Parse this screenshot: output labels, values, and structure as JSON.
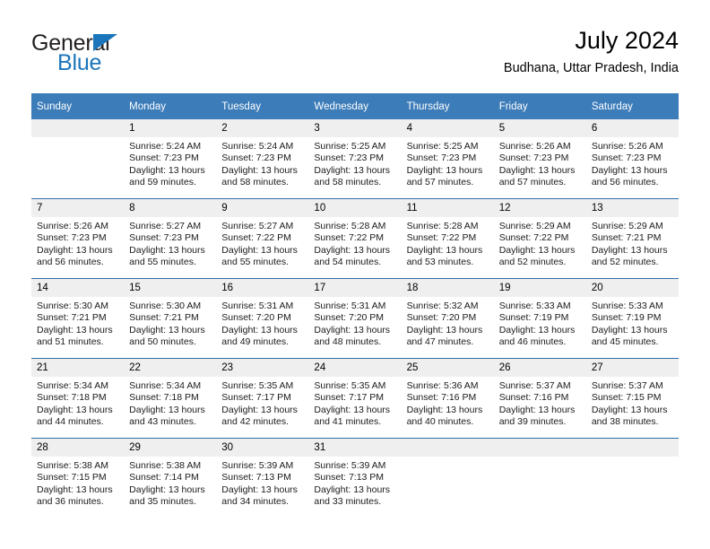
{
  "brand": {
    "name_part1": "General",
    "name_part2": "Blue",
    "colors": {
      "accent": "#1b75bb",
      "header": "#3b7cb9",
      "daynum_band": "#efefef",
      "week_divider": "#2f6fa8"
    }
  },
  "header": {
    "title": "July 2024",
    "subtitle": "Budhana, Uttar Pradesh, India"
  },
  "weekdays": [
    "Sunday",
    "Monday",
    "Tuesday",
    "Wednesday",
    "Thursday",
    "Friday",
    "Saturday"
  ],
  "weeks": [
    [
      {
        "day": "",
        "sunrise": "",
        "sunset": "",
        "daylight": "",
        "blank": true
      },
      {
        "day": "1",
        "sunrise": "Sunrise: 5:24 AM",
        "sunset": "Sunset: 7:23 PM",
        "daylight": "Daylight: 13 hours and 59 minutes."
      },
      {
        "day": "2",
        "sunrise": "Sunrise: 5:24 AM",
        "sunset": "Sunset: 7:23 PM",
        "daylight": "Daylight: 13 hours and 58 minutes."
      },
      {
        "day": "3",
        "sunrise": "Sunrise: 5:25 AM",
        "sunset": "Sunset: 7:23 PM",
        "daylight": "Daylight: 13 hours and 58 minutes."
      },
      {
        "day": "4",
        "sunrise": "Sunrise: 5:25 AM",
        "sunset": "Sunset: 7:23 PM",
        "daylight": "Daylight: 13 hours and 57 minutes."
      },
      {
        "day": "5",
        "sunrise": "Sunrise: 5:26 AM",
        "sunset": "Sunset: 7:23 PM",
        "daylight": "Daylight: 13 hours and 57 minutes."
      },
      {
        "day": "6",
        "sunrise": "Sunrise: 5:26 AM",
        "sunset": "Sunset: 7:23 PM",
        "daylight": "Daylight: 13 hours and 56 minutes."
      }
    ],
    [
      {
        "day": "7",
        "sunrise": "Sunrise: 5:26 AM",
        "sunset": "Sunset: 7:23 PM",
        "daylight": "Daylight: 13 hours and 56 minutes."
      },
      {
        "day": "8",
        "sunrise": "Sunrise: 5:27 AM",
        "sunset": "Sunset: 7:23 PM",
        "daylight": "Daylight: 13 hours and 55 minutes."
      },
      {
        "day": "9",
        "sunrise": "Sunrise: 5:27 AM",
        "sunset": "Sunset: 7:22 PM",
        "daylight": "Daylight: 13 hours and 55 minutes."
      },
      {
        "day": "10",
        "sunrise": "Sunrise: 5:28 AM",
        "sunset": "Sunset: 7:22 PM",
        "daylight": "Daylight: 13 hours and 54 minutes."
      },
      {
        "day": "11",
        "sunrise": "Sunrise: 5:28 AM",
        "sunset": "Sunset: 7:22 PM",
        "daylight": "Daylight: 13 hours and 53 minutes."
      },
      {
        "day": "12",
        "sunrise": "Sunrise: 5:29 AM",
        "sunset": "Sunset: 7:22 PM",
        "daylight": "Daylight: 13 hours and 52 minutes."
      },
      {
        "day": "13",
        "sunrise": "Sunrise: 5:29 AM",
        "sunset": "Sunset: 7:21 PM",
        "daylight": "Daylight: 13 hours and 52 minutes."
      }
    ],
    [
      {
        "day": "14",
        "sunrise": "Sunrise: 5:30 AM",
        "sunset": "Sunset: 7:21 PM",
        "daylight": "Daylight: 13 hours and 51 minutes."
      },
      {
        "day": "15",
        "sunrise": "Sunrise: 5:30 AM",
        "sunset": "Sunset: 7:21 PM",
        "daylight": "Daylight: 13 hours and 50 minutes."
      },
      {
        "day": "16",
        "sunrise": "Sunrise: 5:31 AM",
        "sunset": "Sunset: 7:20 PM",
        "daylight": "Daylight: 13 hours and 49 minutes."
      },
      {
        "day": "17",
        "sunrise": "Sunrise: 5:31 AM",
        "sunset": "Sunset: 7:20 PM",
        "daylight": "Daylight: 13 hours and 48 minutes."
      },
      {
        "day": "18",
        "sunrise": "Sunrise: 5:32 AM",
        "sunset": "Sunset: 7:20 PM",
        "daylight": "Daylight: 13 hours and 47 minutes."
      },
      {
        "day": "19",
        "sunrise": "Sunrise: 5:33 AM",
        "sunset": "Sunset: 7:19 PM",
        "daylight": "Daylight: 13 hours and 46 minutes."
      },
      {
        "day": "20",
        "sunrise": "Sunrise: 5:33 AM",
        "sunset": "Sunset: 7:19 PM",
        "daylight": "Daylight: 13 hours and 45 minutes."
      }
    ],
    [
      {
        "day": "21",
        "sunrise": "Sunrise: 5:34 AM",
        "sunset": "Sunset: 7:18 PM",
        "daylight": "Daylight: 13 hours and 44 minutes."
      },
      {
        "day": "22",
        "sunrise": "Sunrise: 5:34 AM",
        "sunset": "Sunset: 7:18 PM",
        "daylight": "Daylight: 13 hours and 43 minutes."
      },
      {
        "day": "23",
        "sunrise": "Sunrise: 5:35 AM",
        "sunset": "Sunset: 7:17 PM",
        "daylight": "Daylight: 13 hours and 42 minutes."
      },
      {
        "day": "24",
        "sunrise": "Sunrise: 5:35 AM",
        "sunset": "Sunset: 7:17 PM",
        "daylight": "Daylight: 13 hours and 41 minutes."
      },
      {
        "day": "25",
        "sunrise": "Sunrise: 5:36 AM",
        "sunset": "Sunset: 7:16 PM",
        "daylight": "Daylight: 13 hours and 40 minutes."
      },
      {
        "day": "26",
        "sunrise": "Sunrise: 5:37 AM",
        "sunset": "Sunset: 7:16 PM",
        "daylight": "Daylight: 13 hours and 39 minutes."
      },
      {
        "day": "27",
        "sunrise": "Sunrise: 5:37 AM",
        "sunset": "Sunset: 7:15 PM",
        "daylight": "Daylight: 13 hours and 38 minutes."
      }
    ],
    [
      {
        "day": "28",
        "sunrise": "Sunrise: 5:38 AM",
        "sunset": "Sunset: 7:15 PM",
        "daylight": "Daylight: 13 hours and 36 minutes."
      },
      {
        "day": "29",
        "sunrise": "Sunrise: 5:38 AM",
        "sunset": "Sunset: 7:14 PM",
        "daylight": "Daylight: 13 hours and 35 minutes."
      },
      {
        "day": "30",
        "sunrise": "Sunrise: 5:39 AM",
        "sunset": "Sunset: 7:13 PM",
        "daylight": "Daylight: 13 hours and 34 minutes."
      },
      {
        "day": "31",
        "sunrise": "Sunrise: 5:39 AM",
        "sunset": "Sunset: 7:13 PM",
        "daylight": "Daylight: 13 hours and 33 minutes."
      },
      {
        "day": "",
        "sunrise": "",
        "sunset": "",
        "daylight": "",
        "blank": true
      },
      {
        "day": "",
        "sunrise": "",
        "sunset": "",
        "daylight": "",
        "blank": true
      },
      {
        "day": "",
        "sunrise": "",
        "sunset": "",
        "daylight": "",
        "blank": true
      }
    ]
  ]
}
